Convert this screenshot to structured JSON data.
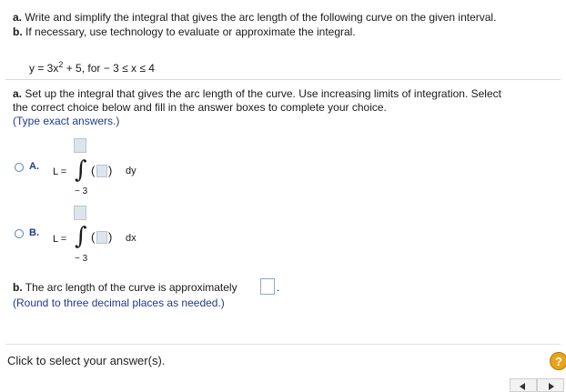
{
  "question": {
    "line_a_prefix": "a.",
    "line_a_text": "Write and simplify the integral that gives the arc length of the following curve on the given interval.",
    "line_b_prefix": "b.",
    "line_b_text": "If necessary, use technology to evaluate or approximate the integral."
  },
  "equation": {
    "lhs": "y = 3x",
    "exponent": "2",
    "rhs": "+ 5, for  − 3 ≤ x ≤ 4"
  },
  "part_a": {
    "prefix": "a.",
    "text_line1": "Set up the integral that gives the arc length of the curve. Use increasing limits of integration. Select",
    "text_line2": "the correct choice below and fill in the answer boxes to complete your choice.",
    "hint": "(Type exact answers.)",
    "choices": [
      {
        "label": "A.",
        "lhs": "L =",
        "integral": "∫",
        "lower": "− 3",
        "open": "(",
        "close": ")",
        "d": "dy"
      },
      {
        "label": "B.",
        "lhs": "L =",
        "integral": "∫",
        "lower": "− 3",
        "open": "(",
        "close": ")",
        "d": "dx"
      }
    ]
  },
  "part_b": {
    "prefix": "b.",
    "text": "The arc length of the curve is approximately",
    "period": ".",
    "hint": "(Round to three decimal places as needed.)"
  },
  "footer": {
    "instruction": "Click to select your answer(s).",
    "help_label": "?"
  }
}
